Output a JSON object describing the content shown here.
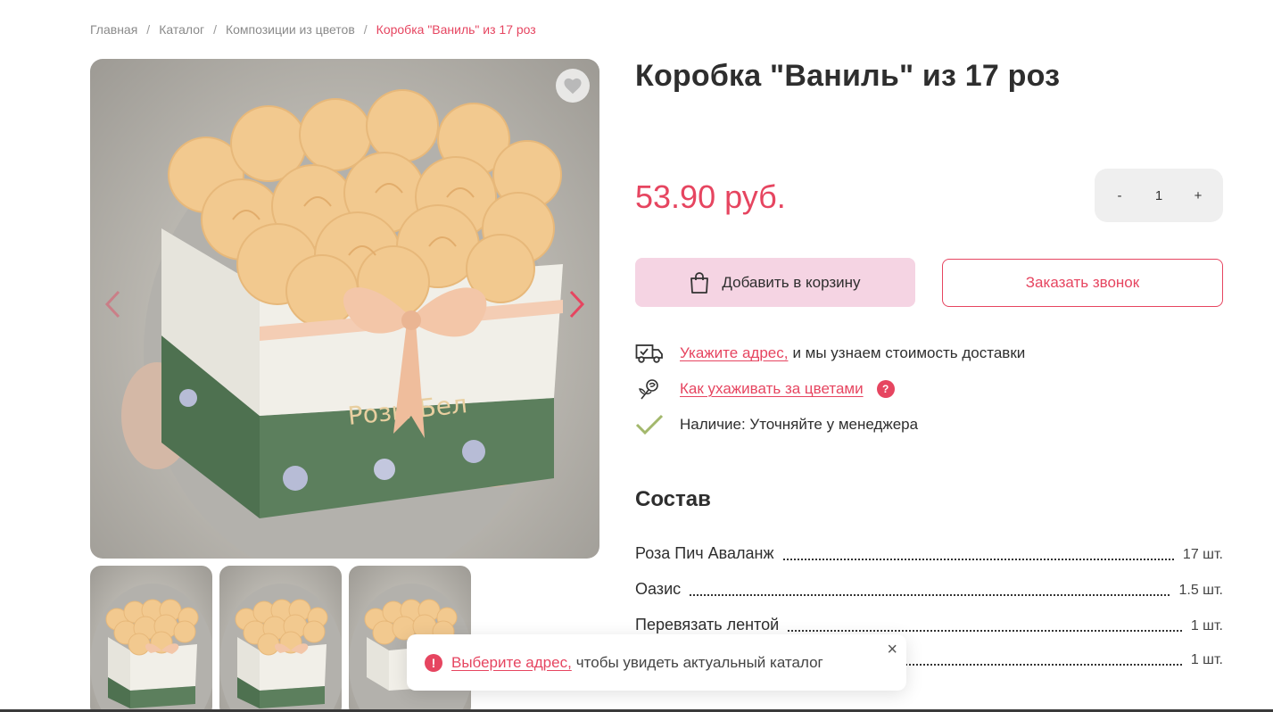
{
  "breadcrumb": {
    "items": [
      "Главная",
      "Каталог",
      "Композиции из цветов"
    ],
    "current": "Коробка \"Ваниль\" из 17 роз",
    "separator": "/"
  },
  "product": {
    "title": "Коробка \"Ваниль\" из 17 роз",
    "price": "53.90 руб.",
    "quantity": "1",
    "qty_minus": "-",
    "qty_plus": "+"
  },
  "actions": {
    "add_to_cart": "Добавить в корзину",
    "order_call": "Заказать звонок"
  },
  "info": {
    "delivery_link": "Укажите адрес,",
    "delivery_text": "и мы узнаем стоимость доставки",
    "care_link": "Как ухаживать за цветами",
    "care_help": "?",
    "availability": "Наличие: Уточняйте у менеджера"
  },
  "composition": {
    "title": "Состав",
    "items": [
      {
        "name": "Роза Пич Аваланж",
        "qty": "17 шт."
      },
      {
        "name": "Оазис",
        "qty": "1.5 шт."
      },
      {
        "name": "Перевязать лентой",
        "qty": "1 шт."
      },
      {
        "name": "",
        "qty": "1 шт."
      }
    ]
  },
  "toast": {
    "icon": "!",
    "link": "Выберите адрес,",
    "text": "чтобы увидеть актуальный каталог",
    "close": "×"
  },
  "colors": {
    "accent": "#e64560",
    "cart_button_bg": "#f5d4e3",
    "qty_bg": "#efefef"
  },
  "icons": [
    "heart-icon",
    "arrow-left-icon",
    "arrow-right-icon",
    "shopping-bag-icon",
    "delivery-truck-icon",
    "rose-icon",
    "check-icon",
    "warning-icon",
    "close-icon"
  ]
}
